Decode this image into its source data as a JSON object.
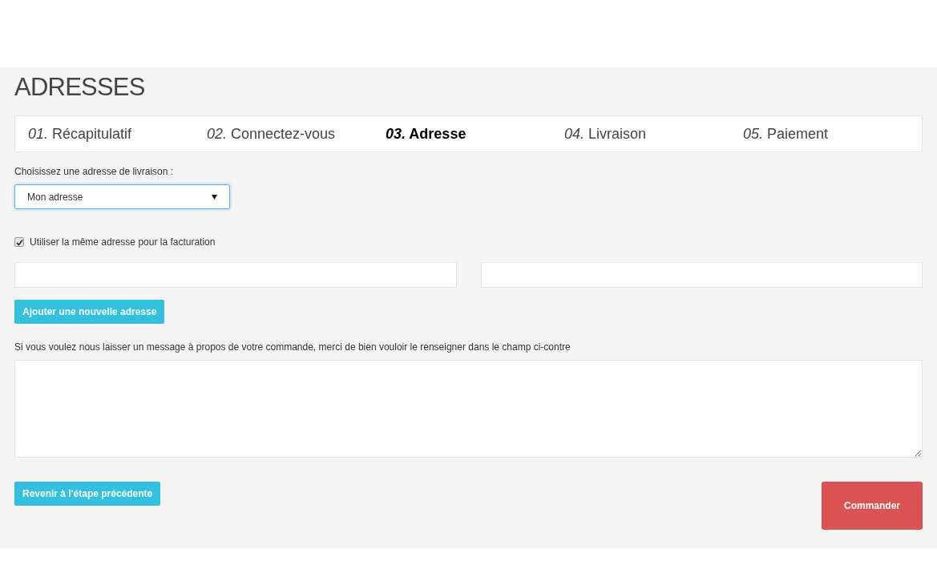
{
  "title": "ADRESSES",
  "steps": [
    {
      "number": "01.",
      "label": "Récapitulatif",
      "selected": false
    },
    {
      "number": "02.",
      "label": "Connectez-vous",
      "selected": false
    },
    {
      "number": "03.",
      "label": "Adresse",
      "selected": true
    },
    {
      "number": "04.",
      "label": "Livraison",
      "selected": false
    },
    {
      "number": "05.",
      "label": "Paiement",
      "selected": false
    }
  ],
  "delivery": {
    "label": "Choisissez une adresse de livraison :",
    "value": "Mon adresse"
  },
  "same_billing": {
    "label": "Utiliser la même adresse pour la facturation",
    "checked": true
  },
  "add_button": "Ajouter une nouvelle adresse",
  "message": {
    "label": "Si vous voulez nous laisser un message à propos de votre commande, merci de bien vouloir le renseigner dans le champ ci-contre"
  },
  "back_button": "Revenir à l'étape précédente",
  "order_button": "Commander"
}
